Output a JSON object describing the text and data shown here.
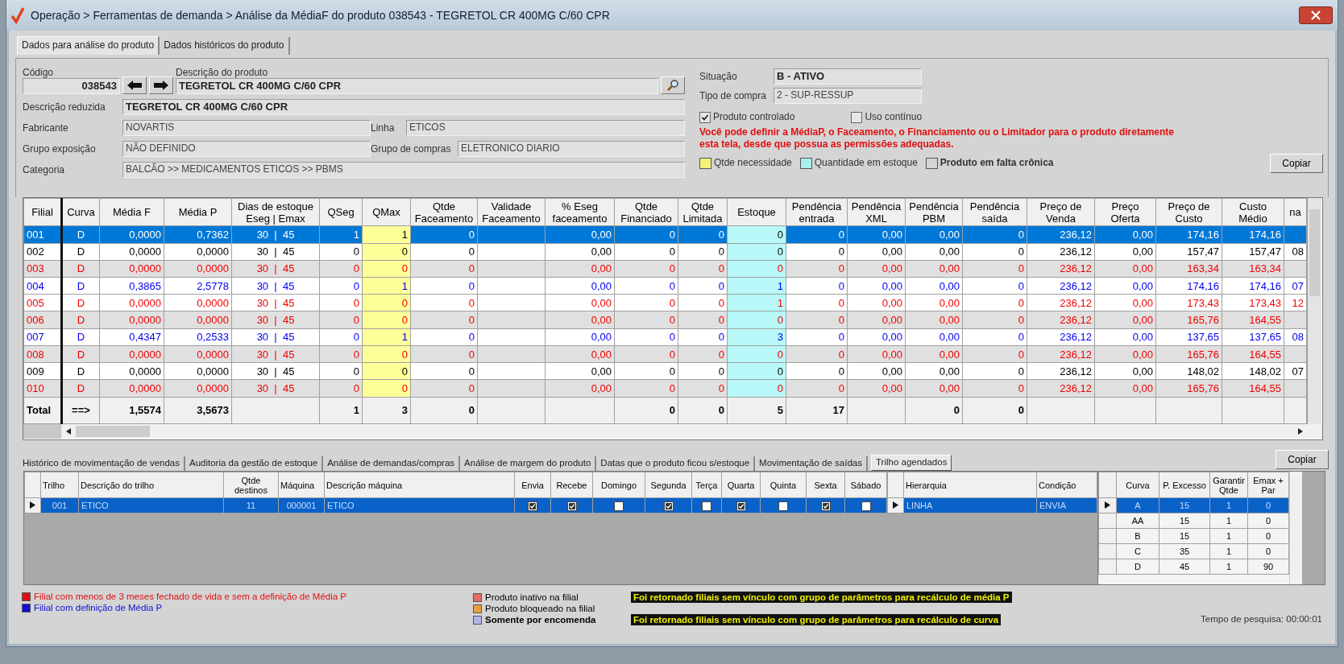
{
  "window": {
    "title": "Operação > Ferramentas de demanda > Análise da MédiaF do produto 038543 - TEGRETOL CR 400MG C/60 CPR"
  },
  "tabs": [
    {
      "label": "Dados para análise do produto",
      "selected": true
    },
    {
      "label": "Dados históricos do produto",
      "selected": false
    }
  ],
  "product": {
    "codigo_label": "Código",
    "codigo": "038543",
    "descricao_label": "Descrição do produto",
    "descricao": "TEGRETOL CR 400MG C/60 CPR",
    "reduzida_label": "Descrição reduzida",
    "reduzida": "TEGRETOL CR 400MG C/60 CPR",
    "fabricante_label": "Fabricante",
    "fabricante": "NOVARTIS",
    "linha_label": "Linha",
    "linha": "ETICOS",
    "exposicao_label": "Grupo exposição",
    "exposicao": "NÃO DEFINIDO",
    "compras_label": "Grupo de compras",
    "compras": "ELETRONICO DIARIO",
    "categoria_label": "Categoria",
    "categoria": "BALCÃO >> MEDICAMENTOS ETICOS >> PBMS",
    "situacao_label": "Situação",
    "situacao": "B - ATIVO",
    "tipo_label": "Tipo de compra",
    "tipo": "2 - SUP-RESSUP",
    "checks": [
      {
        "label": "Produto controlado",
        "checked": true
      },
      {
        "label": "Uso contínuo",
        "checked": false
      }
    ],
    "notice": [
      "Você pode definir a MédiaP, o Faceamento, o Financiamento ou o Limitador para o produto diretamente",
      "esta tela, desde que possua as permissões adequadas."
    ],
    "legend": [
      {
        "label": "Qtde necessidade",
        "color": "#f2f27a",
        "bold": false
      },
      {
        "label": "Quantidade em estoque",
        "color": "#a8f0f0",
        "bold": false
      },
      {
        "label": "Produto em falta crônica",
        "color": "#d4d4d4",
        "bold": true
      }
    ],
    "copy_button": "Copiar"
  },
  "stock": {
    "columns": [
      {
        "label": "Filial"
      },
      {
        "label": "Curva"
      },
      {
        "label": "Média F"
      },
      {
        "label": "Média P"
      },
      {
        "label": "Dias de estoque\nEseg | Emax"
      },
      {
        "label": "QSeg"
      },
      {
        "label": "QMax",
        "color": "#ffff99"
      },
      {
        "label": "Qtde\nFaceamento"
      },
      {
        "label": "Validade\nFaceamento"
      },
      {
        "label": "% Eseg\nfaceamento"
      },
      {
        "label": "Qtde\nFinanciado"
      },
      {
        "label": "Qtde\nLimitada"
      },
      {
        "label": "Estoque",
        "color": "#b8f8f8"
      },
      {
        "label": "Pendência\nentrada"
      },
      {
        "label": "Pendência\nXML"
      },
      {
        "label": "Pendência\nPBM"
      },
      {
        "label": "Pendência\nsaída"
      },
      {
        "label": "Preço de\nVenda"
      },
      {
        "label": "Preço\nOferta"
      },
      {
        "label": "Preço de\nCusto"
      },
      {
        "label": "Custo\nMédio"
      },
      {
        "label": "na"
      }
    ],
    "rows": [
      {
        "kind": "normal",
        "selected": true,
        "shaded": false,
        "cells": [
          "001",
          "D",
          "0,0000",
          "0,7362",
          "30  |  45",
          "1",
          "1",
          "0",
          null,
          "0,00",
          "0",
          "0",
          "0",
          "0",
          "0,00",
          "0,00",
          "0",
          "236,12",
          "0,00",
          "174,16",
          "174,16",
          null
        ]
      },
      {
        "kind": "normal",
        "selected": false,
        "shaded": false,
        "cells": [
          "002",
          "D",
          "0,0000",
          "0,0000",
          "30  |  45",
          "0",
          "0",
          "0",
          null,
          "0,00",
          "0",
          "0",
          "0",
          "0",
          "0,00",
          "0,00",
          "0",
          "236,12",
          "0,00",
          "157,47",
          "157,47",
          "08"
        ]
      },
      {
        "kind": "red",
        "selected": false,
        "shaded": true,
        "cells": [
          "003",
          "D",
          "0,0000",
          "0,0000",
          "30  |  45",
          "0",
          "0",
          "0",
          null,
          "0,00",
          "0",
          "0",
          "0",
          "0",
          "0,00",
          "0,00",
          "0",
          "236,12",
          "0,00",
          "163,34",
          "163,34",
          null
        ]
      },
      {
        "kind": "blue",
        "selected": false,
        "shaded": false,
        "cells": [
          "004",
          "D",
          "0,3865",
          "2,5778",
          "30  |  45",
          "0",
          "1",
          "0",
          null,
          "0,00",
          "0",
          "0",
          "1",
          "0",
          "0,00",
          "0,00",
          "0",
          "236,12",
          "0,00",
          "174,16",
          "174,16",
          "07"
        ]
      },
      {
        "kind": "red",
        "selected": false,
        "shaded": false,
        "cells": [
          "005",
          "D",
          "0,0000",
          "0,0000",
          "30  |  45",
          "0",
          "0",
          "0",
          null,
          "0,00",
          "0",
          "0",
          "1",
          "0",
          "0,00",
          "0,00",
          "0",
          "236,12",
          "0,00",
          "173,43",
          "173,43",
          "12"
        ]
      },
      {
        "kind": "red",
        "selected": false,
        "shaded": true,
        "cells": [
          "006",
          "D",
          "0,0000",
          "0,0000",
          "30  |  45",
          "0",
          "0",
          "0",
          null,
          "0,00",
          "0",
          "0",
          "0",
          "0",
          "0,00",
          "0,00",
          "0",
          "236,12",
          "0,00",
          "165,76",
          "164,55",
          null
        ]
      },
      {
        "kind": "blue",
        "selected": false,
        "shaded": false,
        "cells": [
          "007",
          "D",
          "0,4347",
          "0,2533",
          "30  |  45",
          "0",
          "1",
          "0",
          null,
          "0,00",
          "0",
          "0",
          "3",
          "0",
          "0,00",
          "0,00",
          "0",
          "236,12",
          "0,00",
          "137,65",
          "137,65",
          "08"
        ]
      },
      {
        "kind": "red",
        "selected": false,
        "shaded": true,
        "cells": [
          "008",
          "D",
          "0,0000",
          "0,0000",
          "30  |  45",
          "0",
          "0",
          "0",
          null,
          "0,00",
          "0",
          "0",
          "0",
          "0",
          "0,00",
          "0,00",
          "0",
          "236,12",
          "0,00",
          "165,76",
          "164,55",
          null
        ]
      },
      {
        "kind": "normal",
        "selected": false,
        "shaded": false,
        "cells": [
          "009",
          "D",
          "0,0000",
          "0,0000",
          "30  |  45",
          "0",
          "0",
          "0",
          null,
          "0,00",
          "0",
          "0",
          "0",
          "0",
          "0,00",
          "0,00",
          "0",
          "236,12",
          "0,00",
          "148,02",
          "148,02",
          "07"
        ]
      },
      {
        "kind": "red",
        "selected": false,
        "shaded": true,
        "cells": [
          "010",
          "D",
          "0,0000",
          "0,0000",
          "30  |  45",
          "0",
          "0",
          "0",
          null,
          "0,00",
          "0",
          "0",
          "0",
          "0",
          "0,00",
          "0,00",
          "0",
          "236,12",
          "0,00",
          "165,76",
          "164,55",
          null
        ]
      },
      {
        "kind": "total",
        "selected": false,
        "shaded": false,
        "cells": [
          "Total",
          "==>",
          "1,5574",
          "3,5673",
          null,
          "1",
          "3",
          "0",
          null,
          null,
          "0",
          "0",
          "5",
          "17",
          null,
          "0",
          "0",
          null,
          null,
          null,
          null,
          null
        ]
      }
    ]
  },
  "bottom_tabs": [
    {
      "label": "Histórico de movimentação de vendas",
      "selected": false
    },
    {
      "label": "Auditoria da gestão de estoque",
      "selected": false
    },
    {
      "label": "Análise de demandas/compras",
      "selected": false
    },
    {
      "label": "Análise de margem do produto",
      "selected": false
    },
    {
      "label": "Datas que o produto ficou s/estoque",
      "selected": false
    },
    {
      "label": "Movimentação de saídas",
      "selected": false
    },
    {
      "label": "Trilho agendados",
      "selected": true
    }
  ],
  "bottom_copy_button": "Copiar",
  "routes": {
    "columns": [
      "Trilho",
      "Descrição do trilho",
      "Qtde destinos",
      "Máquina",
      "Descrição máquina",
      "Envia",
      "Recebe",
      "Domingo",
      "Segunda",
      "Terça",
      "Quarta",
      "Quinta",
      "Sexta",
      "Sábado"
    ],
    "rows": [
      {
        "selected": true,
        "cells": [
          "001",
          "ETICO",
          "11",
          "000001",
          "ETICO"
        ],
        "flags": [
          {
            "checked": true
          },
          {
            "checked": true
          },
          {
            "checked": false
          },
          {
            "checked": true
          },
          {
            "checked": false
          },
          {
            "checked": true
          },
          {
            "checked": false
          },
          {
            "checked": true
          },
          {
            "checked": false
          }
        ]
      }
    ]
  },
  "hierarchy": {
    "columns": [
      "Hierarquia",
      "Condição"
    ],
    "rows": [
      {
        "selected": true,
        "cells": [
          "LINHA",
          "ENVIA"
        ]
      }
    ]
  },
  "curves": {
    "columns": [
      "Curva",
      "P. Excesso",
      "Garantir Qtde",
      "Emax + Par"
    ],
    "rows": [
      {
        "selected": true,
        "cells": [
          "A",
          "15",
          "1",
          "0"
        ]
      },
      {
        "selected": false,
        "cells": [
          "AA",
          "15",
          "1",
          "0"
        ]
      },
      {
        "selected": false,
        "cells": [
          "B",
          "15",
          "1",
          "0"
        ]
      },
      {
        "selected": false,
        "cells": [
          "C",
          "35",
          "1",
          "0"
        ]
      },
      {
        "selected": false,
        "cells": [
          "D",
          "45",
          "1",
          "90"
        ]
      }
    ]
  },
  "legend": {
    "branches": [
      {
        "label": "Filial com menos de 3 meses fechado de vida e sem a definição de Média P",
        "color": "#e01010"
      },
      {
        "label": "Filial com definição de Média P",
        "color": "#1010d8"
      }
    ],
    "products": [
      {
        "label": "Produto inativo na filial",
        "color": "#e86a6a",
        "bold": false
      },
      {
        "label": "Produto bloqueado na filial",
        "color": "#e8a040",
        "bold": false
      },
      {
        "label": "Somente por encomenda",
        "color": "#b4b4ec",
        "bold": true
      }
    ],
    "messages": [
      "Foi retornado filiais sem vínculo com grupo de parâmetros para recálculo de média P",
      "Foi retornado filiais sem vínculo com grupo de parâmetros para recálculo de curva"
    ],
    "search_time": "Tempo de pesquisa: 00:00:01"
  }
}
